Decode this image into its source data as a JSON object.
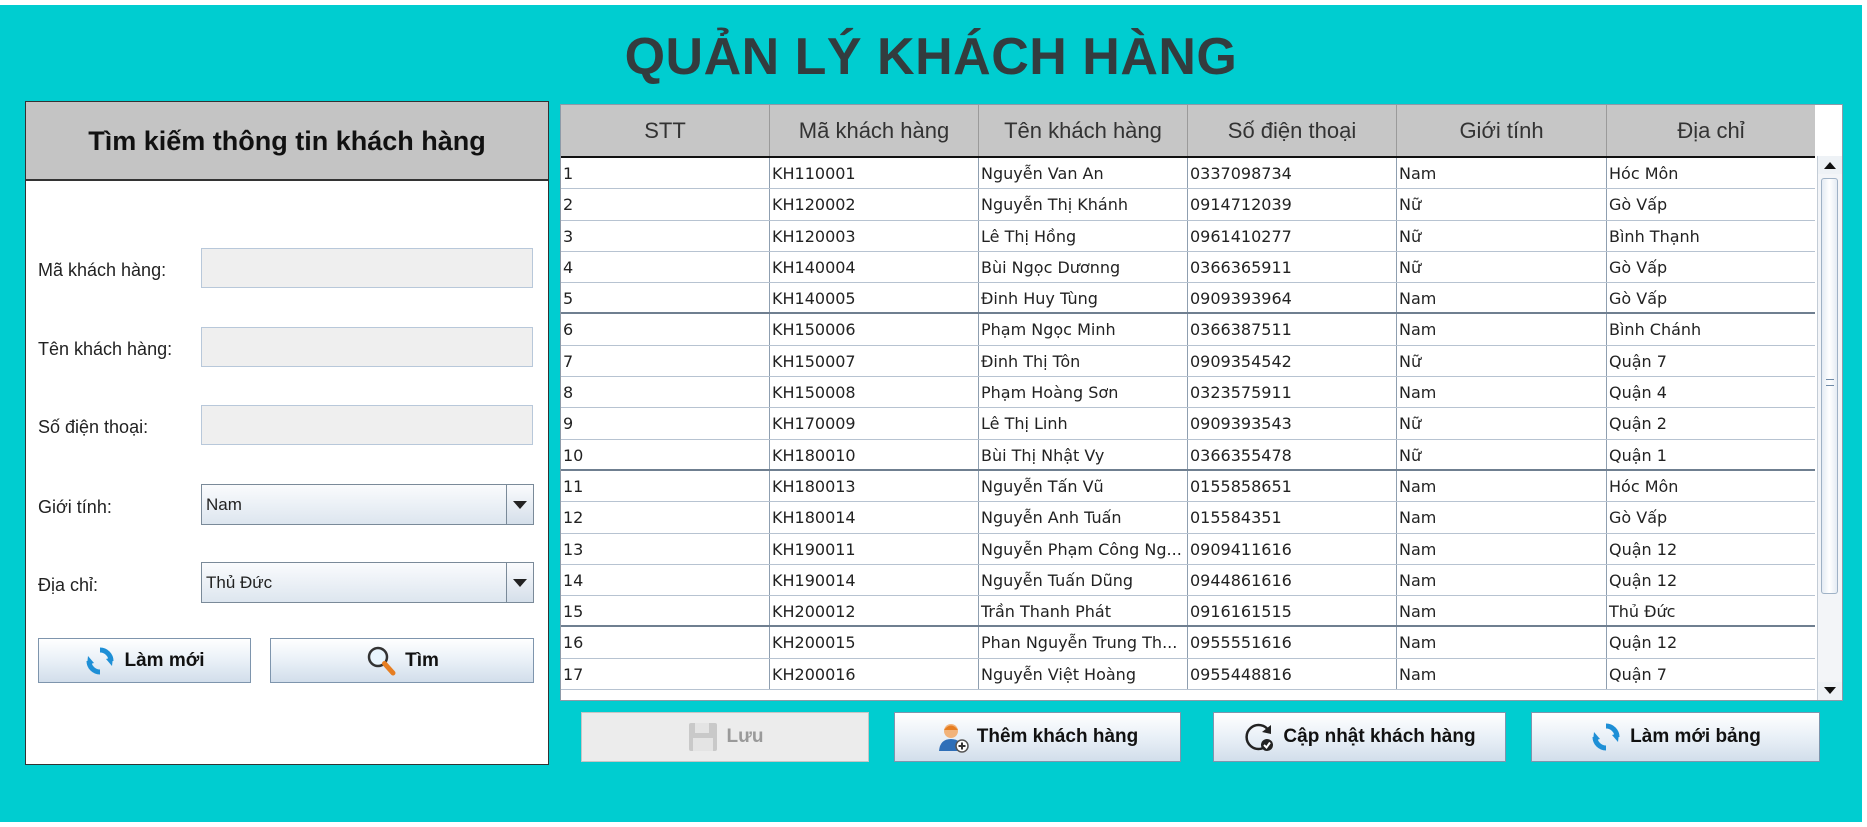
{
  "title": "QUẢN LÝ KHÁCH HÀNG",
  "colors": {
    "background": "#00cdd0",
    "header_gray": "#c6c6c6"
  },
  "search": {
    "heading": "Tìm kiếm thông tin khách hàng",
    "fields": {
      "customer_id": {
        "label": "Mã khách hàng:",
        "value": ""
      },
      "customer_name": {
        "label": "Tên khách hàng:",
        "value": ""
      },
      "phone": {
        "label": "Số điện thoại:",
        "value": ""
      },
      "gender": {
        "label": "Giới tính:",
        "value": "Nam"
      },
      "address": {
        "label": "Địa chỉ:",
        "value": "Thủ Đức"
      }
    },
    "refresh_button": {
      "label": "Làm mới",
      "icon": "refresh-icon"
    },
    "find_button": {
      "label": "Tìm",
      "icon": "magnifier-icon"
    }
  },
  "table": {
    "columns": [
      "STT",
      "Mã khách hàng",
      "Tên khách hàng",
      "Số điện thoại",
      "Giới tính",
      "Địa chỉ"
    ],
    "rows": [
      [
        "1",
        "KH110001",
        "Nguyễn Van An",
        "0337098734",
        "Nam",
        "Hóc Môn"
      ],
      [
        "2",
        "KH120002",
        "Nguyễn Thị Khánh",
        "0914712039",
        "Nữ",
        "Gò Vấp"
      ],
      [
        "3",
        "KH120003",
        "Lê Thị Hồng",
        "0961410277",
        "Nữ",
        "Bình Thạnh"
      ],
      [
        "4",
        "KH140004",
        "Bùi Ngọc Dươnng",
        "0366365911",
        "Nữ",
        "Gò Vấp"
      ],
      [
        "5",
        "KH140005",
        "Đinh Huy Tùng",
        "0909393964",
        "Nam",
        "Gò Vấp"
      ],
      [
        "6",
        "KH150006",
        "Phạm Ngọc Minh",
        "0366387511",
        "Nam",
        "Bình Chánh"
      ],
      [
        "7",
        "KH150007",
        "Đinh Thị Tôn",
        "0909354542",
        "Nữ",
        "Quận 7"
      ],
      [
        "8",
        "KH150008",
        "Phạm Hoàng Sơn",
        "0323575911",
        "Nam",
        "Quận 4"
      ],
      [
        "9",
        "KH170009",
        "Lê Thị Linh",
        "0909393543",
        "Nữ",
        "Quận 2"
      ],
      [
        "10",
        "KH180010",
        "Bùi Thị Nhật Vy",
        "0366355478",
        "Nữ",
        "Quận 1"
      ],
      [
        "11",
        "KH180013",
        "Nguyễn Tấn Vũ",
        "0155858651",
        "Nam",
        "Hóc Môn"
      ],
      [
        "12",
        "KH180014",
        "Nguyễn Anh Tuấn",
        "015584351",
        "Nam",
        "Gò Vấp"
      ],
      [
        "13",
        "KH190011",
        "Nguyễn Phạm Công Ng...",
        "0909411616",
        "Nam",
        "Quận 12"
      ],
      [
        "14",
        "KH190014",
        "Nguyễn Tuấn Dũng",
        "0944861616",
        "Nam",
        "Quận 12"
      ],
      [
        "15",
        "KH200012",
        "Trần Thanh Phát",
        "0916161515",
        "Nam",
        "Thủ Đức"
      ],
      [
        "16",
        "KH200015",
        "Phan Nguyễn Trung Th...",
        "0955551616",
        "Nam",
        "Quận 12"
      ],
      [
        "17",
        "KH200016",
        "Nguyễn Việt Hoàng",
        "0955448816",
        "Nam",
        "Quận 7"
      ]
    ]
  },
  "actions": {
    "save": {
      "label": "Lưu",
      "icon": "floppy-disk-icon",
      "enabled": false
    },
    "add": {
      "label": "Thêm khách hàng",
      "icon": "add-user-icon"
    },
    "update": {
      "label": "Cập nhật khách hàng",
      "icon": "update-icon"
    },
    "reload": {
      "label": "Làm mới bảng",
      "icon": "refresh-icon"
    }
  }
}
